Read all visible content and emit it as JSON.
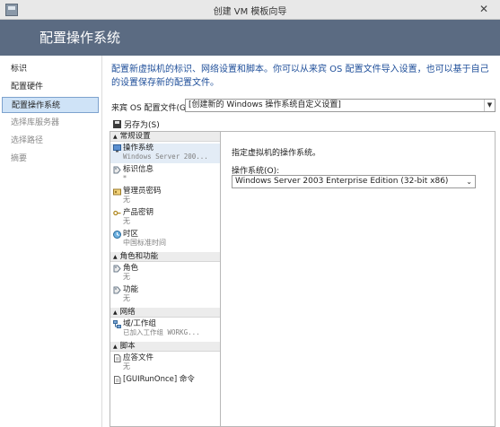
{
  "window": {
    "title": "创建 VM 模板向导",
    "close_glyph": "✕"
  },
  "header": {
    "title": "配置操作系统"
  },
  "sidebar": {
    "items": [
      {
        "label": "标识",
        "state": "normal"
      },
      {
        "label": "配置硬件",
        "state": "normal"
      },
      {
        "label": "配置操作系统",
        "state": "active"
      },
      {
        "label": "选择库服务器",
        "state": "disabled"
      },
      {
        "label": "选择路径",
        "state": "disabled"
      },
      {
        "label": "摘要",
        "state": "disabled"
      }
    ]
  },
  "main": {
    "intro": "配置新虚拟机的标识、网络设置和脚本。你可以从来宾 OS 配置文件导入设置，也可以基于自己的设置保存新的配置文件。",
    "profile_label": "来宾 OS 配置文件(G):",
    "profile_value": "[创建新的 Windows 操作系统自定义设置]",
    "saveas_label": "另存为(S)"
  },
  "tree": {
    "groups": [
      {
        "label": "常规设置"
      },
      {
        "label": "角色和功能"
      },
      {
        "label": "网络"
      },
      {
        "label": "脚本"
      }
    ],
    "items": [
      {
        "label": "操作系统",
        "sub": "Windows Server 200..."
      },
      {
        "label": "标识信息",
        "sub": "*"
      },
      {
        "label": "管理员密码",
        "sub": "无"
      },
      {
        "label": "产品密钥",
        "sub": "无"
      },
      {
        "label": "时区",
        "sub": "中国标准时间"
      },
      {
        "label": "角色",
        "sub": "无"
      },
      {
        "label": "功能",
        "sub": "无"
      },
      {
        "label": "域/工作组",
        "sub": "已加入工作组 WORKG..."
      },
      {
        "label": "应答文件",
        "sub": "无"
      },
      {
        "label": "[GUIRunOnce] 命令",
        "sub": ""
      }
    ]
  },
  "details": {
    "description": "指定虚拟机的操作系统。",
    "os_label": "操作系统(O):",
    "os_value": "Windows Server 2003 Enterprise Edition (32-bit x86)"
  }
}
